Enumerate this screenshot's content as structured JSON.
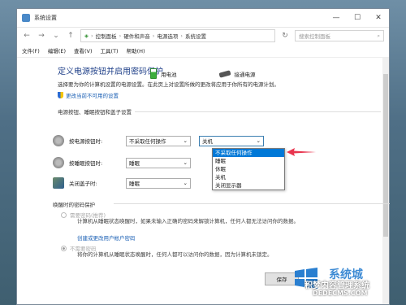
{
  "window": {
    "title": "系统设置",
    "controls": {
      "minimize": "—",
      "maximize": "☐",
      "close": "✕"
    }
  },
  "nav": {
    "breadcrumbs": [
      "控制面板",
      "硬件和声音",
      "电源选项",
      "系统设置"
    ],
    "search_placeholder": "搜索控制面板"
  },
  "menu": [
    "文件(F)",
    "编辑(E)",
    "查看(V)",
    "工具(T)",
    "帮助(H)"
  ],
  "main": {
    "title": "定义电源按钮并启用密码保护",
    "intro": "选择要为你的计算机设置的电源设置。在此页上对设置所做的更改将应用于你所有的电源计划。",
    "change_link": "更改当前不可用的设置",
    "section_buttons": "电源按钮、睡眠按钮和盖子设置",
    "col_battery": "用电池",
    "col_plugged": "接通电源",
    "rows": [
      {
        "label": "按电源按钮时:",
        "battery": "不采取任何操作",
        "plugged": "关机"
      },
      {
        "label": "按睡眠按钮时:",
        "battery": "睡眠",
        "plugged": ""
      },
      {
        "label": "关闭盖子时:",
        "battery": "睡眠",
        "plugged": ""
      }
    ],
    "dropdown_options": [
      "不采取任何操作",
      "睡眠",
      "休眠",
      "关机",
      "关闭显示器"
    ],
    "dropdown_selected_index": 0,
    "section_password": "唤醒时的密码保护",
    "require_password": "需要密码(推荐)",
    "require_password_desc": "计算机从睡眠状态唤醒时，如果未输入正确的密码来解锁计算机，任何人都无法访问你的数据。",
    "create_password_link": "创建或更改用户帐户密码",
    "no_password": "不需要密码",
    "no_password_desc": "将你的计算机从睡眠状态唤醒时，任何人都可以访问你的数据，因为计算机未锁定。",
    "save_label": "保存"
  },
  "watermark": {
    "logo_text": "系统城",
    "line1": "积梦内容管理系统",
    "url": "DEDECMS.COM"
  },
  "colors": {
    "accent": "#1e3f88",
    "link": "#1a5fb4",
    "highlight": "#0078d7",
    "arrow": "#e8344e"
  }
}
